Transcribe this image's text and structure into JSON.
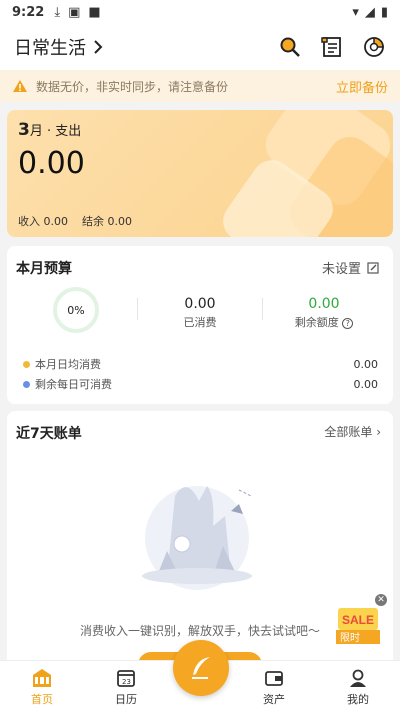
{
  "status_bar": {
    "time": "9:22"
  },
  "header": {
    "book_name": "日常生活"
  },
  "notice": {
    "text": "数据无价，非实时同步，请注意备份",
    "action": "立即备份"
  },
  "summary": {
    "month_num": "3",
    "month_suffix": "月 · 支出",
    "expense": "0.00",
    "income_label": "收入",
    "income": "0.00",
    "balance_label": "结余",
    "balance": "0.00"
  },
  "budget": {
    "title": "本月预算",
    "setup_label": "未设置",
    "percent": "0%",
    "spent_value": "0.00",
    "spent_label": "已消费",
    "remaining_value": "0.00",
    "remaining_label": "剩余额度",
    "rows": [
      {
        "label": "本月日均消费",
        "value": "0.00",
        "dot_color": "#f0b93a"
      },
      {
        "label": "剩余每日可消费",
        "value": "0.00",
        "dot_color": "#6b8fe8"
      }
    ]
  },
  "recent": {
    "title": "近7天账单",
    "all_label": "全部账单",
    "empty_tip": "消费收入一键识别，解放双手，快去试试吧～"
  },
  "sale_badge": {
    "text": "限时"
  },
  "tabs": [
    {
      "label": "首页",
      "icon": "home-icon",
      "active": true
    },
    {
      "label": "日历",
      "icon": "calendar-icon",
      "active": false
    },
    {
      "label": "资产",
      "icon": "wallet-icon",
      "active": false
    },
    {
      "label": "我的",
      "icon": "profile-icon",
      "active": false
    }
  ],
  "colors": {
    "accent": "#f0a21b",
    "green": "#2eaa3d",
    "card_bg": "#fcd28d"
  }
}
